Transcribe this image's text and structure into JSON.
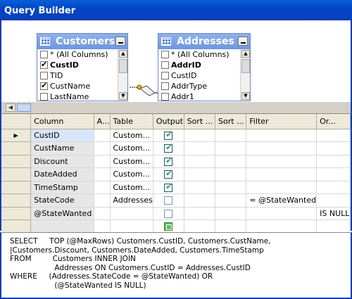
{
  "window": {
    "title": "Query Builder"
  },
  "diagram": {
    "tables": [
      {
        "name": "Customers",
        "columns": [
          {
            "label": "* (All Columns)",
            "checked": false,
            "bold": false
          },
          {
            "label": "CustID",
            "checked": true,
            "bold": true
          },
          {
            "label": "TID",
            "checked": false,
            "bold": false
          },
          {
            "label": "CustName",
            "checked": true,
            "bold": false
          },
          {
            "label": "LastName",
            "checked": false,
            "bold": false
          }
        ]
      },
      {
        "name": "Addresses",
        "columns": [
          {
            "label": "* (All Columns)",
            "checked": false,
            "bold": false
          },
          {
            "label": "AddrID",
            "checked": false,
            "bold": true
          },
          {
            "label": "CustID",
            "checked": false,
            "bold": false
          },
          {
            "label": "AddrType",
            "checked": false,
            "bold": false
          },
          {
            "label": "Addr1",
            "checked": false,
            "bold": false
          }
        ]
      }
    ]
  },
  "grid": {
    "headers": [
      "Column",
      "A...",
      "Table",
      "Output",
      "Sort ...",
      "Sort ...",
      "Filter",
      "Or..."
    ],
    "rows": [
      {
        "column": "CustID",
        "alias": "",
        "table": "Custom...",
        "output": "checked",
        "filter": "",
        "or": ""
      },
      {
        "column": "CustName",
        "alias": "",
        "table": "Custom...",
        "output": "checked",
        "filter": "",
        "or": ""
      },
      {
        "column": "Discount",
        "alias": "",
        "table": "Custom...",
        "output": "checked",
        "filter": "",
        "or": ""
      },
      {
        "column": "DateAdded",
        "alias": "",
        "table": "Custom...",
        "output": "checked",
        "filter": "",
        "or": ""
      },
      {
        "column": "TimeStamp",
        "alias": "",
        "table": "Custom...",
        "output": "checked",
        "filter": "",
        "or": ""
      },
      {
        "column": "StateCode",
        "alias": "",
        "table": "Addresses",
        "output": "unchecked",
        "filter": "= @StateWanted",
        "or": ""
      },
      {
        "column": "@StateWanted",
        "alias": "",
        "table": "",
        "output": "unchecked",
        "filter": "",
        "or": "IS NULL"
      },
      {
        "column": "",
        "alias": "",
        "table": "",
        "output": "new",
        "filter": "",
        "or": ""
      }
    ]
  },
  "sql": {
    "lines": [
      "SELECT     TOP (@MaxRows) Customers.CustID, Customers.CustName,",
      "|Customers.Discount, Customers.DateAdded, Customers.TimeStamp",
      "FROM         Customers INNER JOIN",
      "                   Addresses ON Customers.CustID = Addresses.CustID",
      "WHERE     (Addresses.StateCode = @StateWanted) OR",
      "                   (@StateWanted IS NULL)"
    ]
  }
}
